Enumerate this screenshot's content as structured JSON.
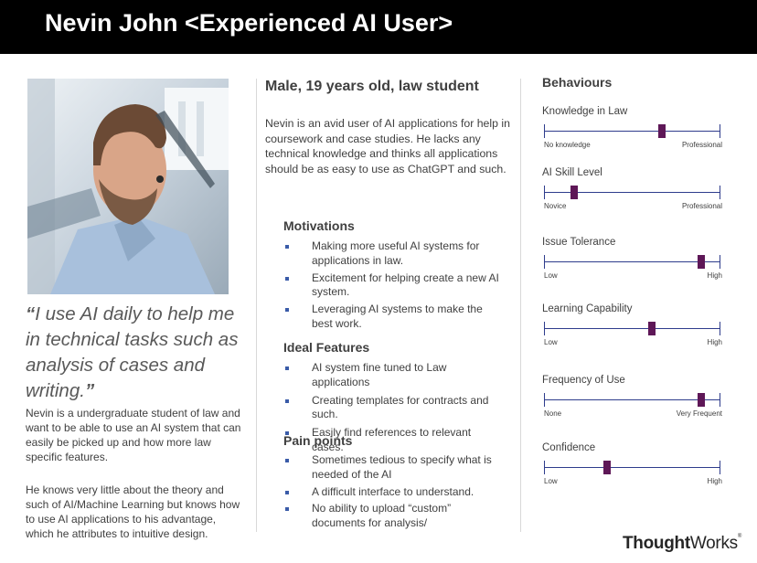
{
  "header": {
    "title": "Nevin John <Experienced AI User>"
  },
  "profile": {
    "quote": "I use AI daily to help me in technical tasks such as analysis of cases and writing.",
    "bio_1": "Nevin is a undergraduate student of law and want to be able to use an AI system that can easily be picked up and how more law specific features.",
    "bio_2": "He knows very little about the theory and such of AI/Machine Learning but knows how to use AI applications to his advantage, which he attributes to intuitive design."
  },
  "details": {
    "demographics": "Male, 19 years old, law student",
    "description": "Nevin is an avid user of AI applications for help in coursework and case studies. He lacks any technical knowledge and thinks all applications should be as easy to use as ChatGPT and such.",
    "motivations": {
      "title": "Motivations",
      "items": [
        "Making more useful AI systems for applications in law.",
        "Excitement for helping create a new AI system.",
        "Leveraging AI systems to make the best work."
      ]
    },
    "ideal_features": {
      "title": "Ideal Features",
      "items": [
        "AI system fine tuned to Law applications",
        " Creating templates for contracts and such.",
        "Easily find references to relevant cases."
      ]
    },
    "pain_points": {
      "title": "Pain points",
      "items": [
        "Sometimes tedious to specify what is needed of the AI",
        "A difficult interface to understand.",
        "No ability to upload “custom” documents for analysis/"
      ]
    }
  },
  "behaviours": {
    "title": "Behaviours",
    "sliders": [
      {
        "label": "Knowledge in Law",
        "low": "No knowledge",
        "high": "Professional",
        "value": 0.67
      },
      {
        "label": "AI Skill Level",
        "low": "Novice",
        "high": "Professional",
        "value": 0.17
      },
      {
        "label": "Issue Tolerance",
        "low": "Low",
        "high": "High",
        "value": 0.89
      },
      {
        "label": "Learning Capability",
        "low": "Low",
        "high": "High",
        "value": 0.61
      },
      {
        "label": "Frequency of Use",
        "low": "None",
        "high": "Very Frequent",
        "value": 0.89
      },
      {
        "label": "Confidence",
        "low": "Low",
        "high": "High",
        "value": 0.36
      }
    ]
  },
  "logo": {
    "bold": "Thought",
    "regular": "Works",
    "mark": "®"
  },
  "colors": {
    "header_bg": "#000000",
    "track": "#2e3c8c",
    "thumb": "#5e1757",
    "bullet": "#3a5ba8"
  }
}
